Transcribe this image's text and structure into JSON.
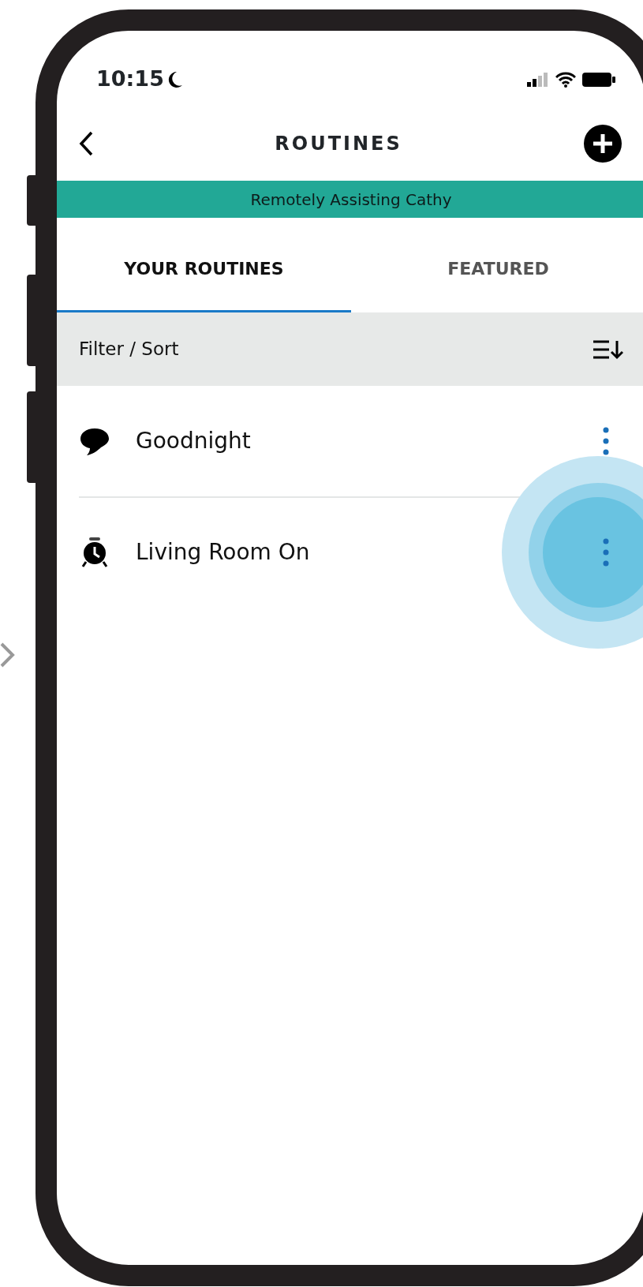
{
  "status_bar": {
    "time": "10:15",
    "do_not_disturb": true
  },
  "header": {
    "title": "ROUTINES"
  },
  "banner": {
    "text": "Remotely Assisting Cathy"
  },
  "tabs": [
    {
      "label": "YOUR ROUTINES",
      "selected": true
    },
    {
      "label": "FEATURED",
      "selected": false
    }
  ],
  "filter": {
    "label": "Filter / Sort"
  },
  "routines": [
    {
      "name": "Goodnight",
      "kind": "voice",
      "pressed": false
    },
    {
      "name": "Living Room On",
      "kind": "alarm",
      "pressed": true
    }
  ]
}
